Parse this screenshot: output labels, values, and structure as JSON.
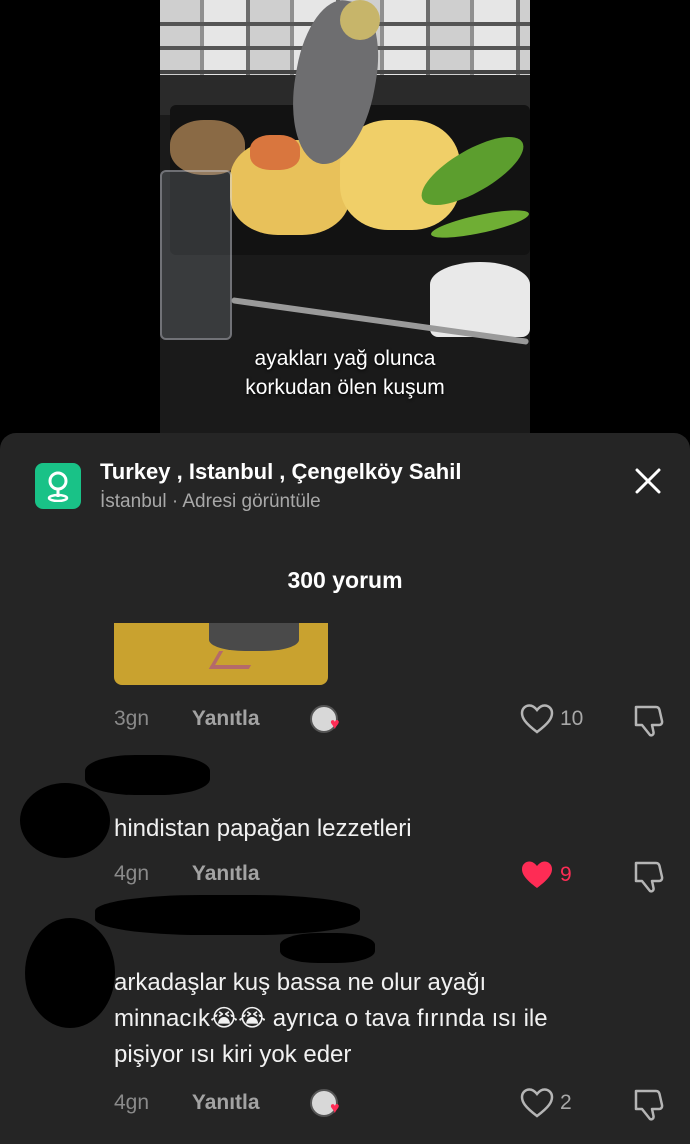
{
  "video": {
    "caption_line1": "ayakları yağ olunca",
    "caption_line2": "korkudan ölen kuşum"
  },
  "location": {
    "title": "Turkey , Istanbul , Çengelköy Sahil",
    "subtitle": "İstanbul · Adresi görüntüle",
    "icon": "location-pin-icon"
  },
  "comments_header": {
    "count_label": "300 yorum"
  },
  "comments": [
    {
      "time": "3gn",
      "reply_label": "Yanıtla",
      "likes": "10",
      "liked": false,
      "has_image": true
    },
    {
      "text": "hindistan papağan lezzetleri",
      "time": "4gn",
      "reply_label": "Yanıtla",
      "likes": "9",
      "liked": true
    },
    {
      "text_line1": "arkadaşlar kuş bassa ne olur ayağı",
      "text_line2": "minnacık😭😭 ayrıca o tava fırında ısı ile",
      "text_line3": "pişiyor ısı kiri yok eder",
      "time": "4gn",
      "reply_label": "Yanıtla",
      "likes": "2",
      "liked": false
    }
  ],
  "colors": {
    "sheet_bg": "#252525",
    "location_icon": "#19c287",
    "like_active": "#fe2c55"
  }
}
